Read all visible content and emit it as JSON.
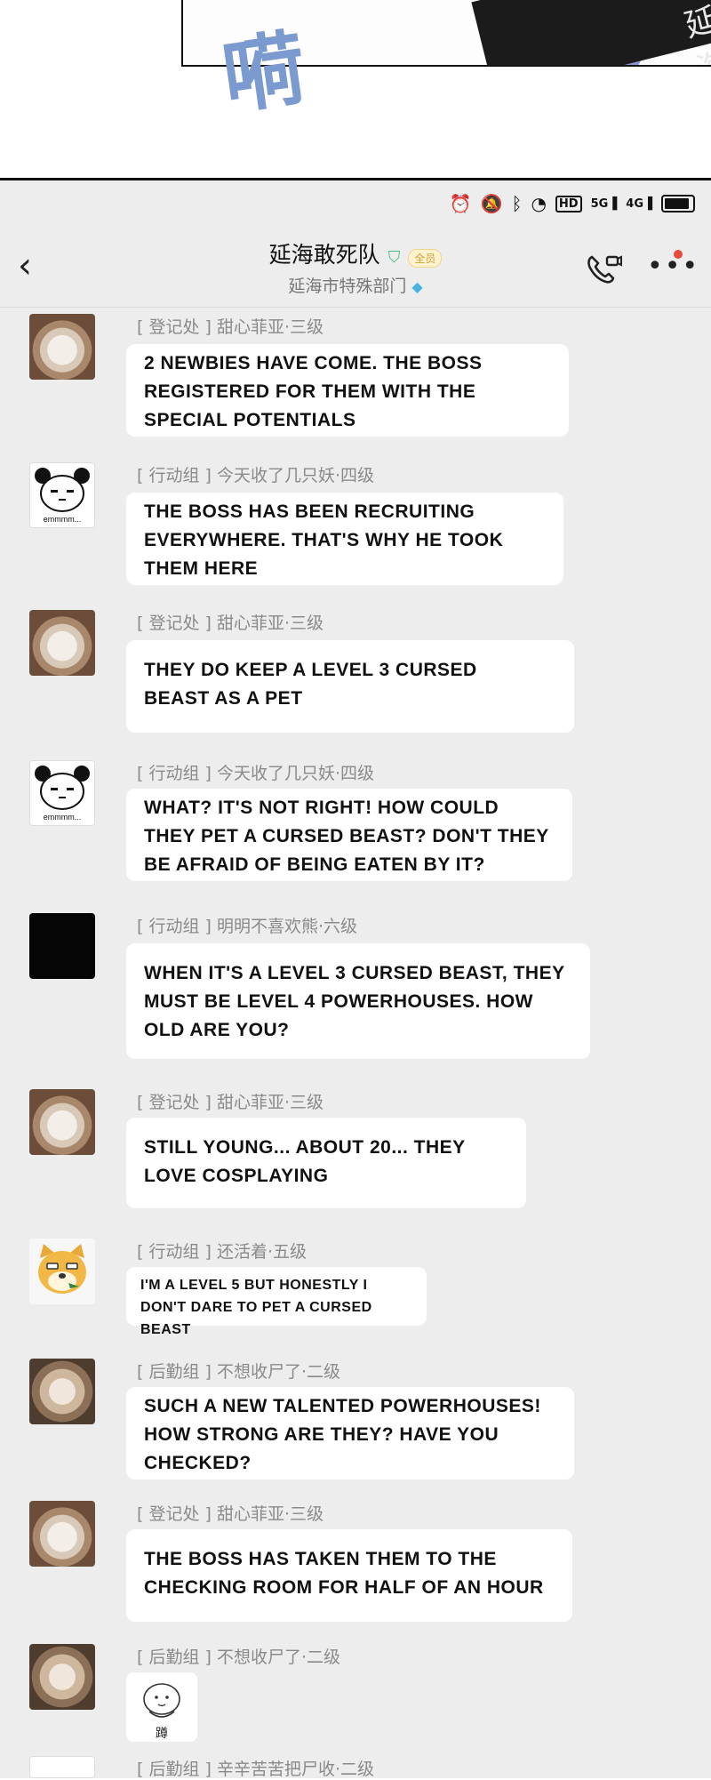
{
  "comic": {
    "sfx": "嗬",
    "panel_text": "延海"
  },
  "status_bar": {
    "icons": [
      "alarm-icon",
      "mute-icon",
      "bluetooth-icon",
      "wifi-icon",
      "hd-icon",
      "signal-5g-icon",
      "signal-4g-icon",
      "battery-icon"
    ],
    "hd": "HD",
    "sig5": "5G",
    "sig4": "4G"
  },
  "header": {
    "back": "<",
    "title": "延海敢死队",
    "badge": "全员",
    "subtitle": "延海市特殊部门",
    "more": "•••"
  },
  "messages": [
    {
      "sender": "[ 登记处 ] 甜心菲亚·三级",
      "text": "2 NEWBIES HAVE COME. THE BOSS\n REGISTERED FOR THEM WITH THE SPECIAL POTENTIALS",
      "avatar": "cat-avatar"
    },
    {
      "sender": "[ 行动组 ] 今天收了几只妖·四级",
      "text": "THE BOSS HAS BEEN RECRUITING EVERYWHERE. THAT'S WHY HE TOOK THEM HERE",
      "avatar": "panda-avatar"
    },
    {
      "sender": "[ 登记处 ] 甜心菲亚·三级",
      "text": "THEY DO KEEP A LEVEL 3 CURSED BEAST AS A PET",
      "avatar": "cat-avatar"
    },
    {
      "sender": "[ 行动组 ] 今天收了几只妖·四级",
      "text": "WHAT? IT'S NOT RIGHT! HOW COULD THEY PET A CURSED BEAST? DON'T THEY BE AFRAID OF BEING EATEN BY IT?",
      "avatar": "panda-avatar"
    },
    {
      "sender": "[ 行动组 ] 明明不喜欢熊·六级",
      "text": "WHEN IT'S A LEVEL 3 CURSED BEAST, THEY MUST BE LEVEL 4 POWERHOUSES. HOW OLD ARE YOU?",
      "avatar": "black-avatar"
    },
    {
      "sender": "[ 登记处 ] 甜心菲亚·三级",
      "text": "STILL YOUNG... ABOUT 20... THEY LOVE COSPLAYING",
      "avatar": "cat-avatar"
    },
    {
      "sender": "[ 行动组 ] 还活着·五级",
      "text": "I'M A LEVEL 5 BUT HONESTLY I DON'T DARE TO PET A CURSED BEAST",
      "avatar": "doge-avatar"
    },
    {
      "sender": "[ 后勤组 ] 不想收尸了·二级",
      "text": "SUCH A NEW TALENTED POWERHOUSES! HOW STRONG ARE THEY? HAVE YOU CHECKED?",
      "avatar": "kitten-avatar"
    },
    {
      "sender": "[ 登记处 ] 甜心菲亚·三级",
      "text": "THE BOSS HAS TAKEN THEM TO THE\n CHECKING ROOM FOR HALF OF AN HOUR",
      "avatar": "cat-avatar"
    },
    {
      "sender": "[ 后勤组 ] 不想收尸了·二级",
      "sticker_text": "蹲",
      "avatar": "kitten-avatar"
    },
    {
      "sender": "[ 后勤组 ] 辛辛苦苦把尸收·二级",
      "avatar": "sticker-avatar"
    }
  ]
}
